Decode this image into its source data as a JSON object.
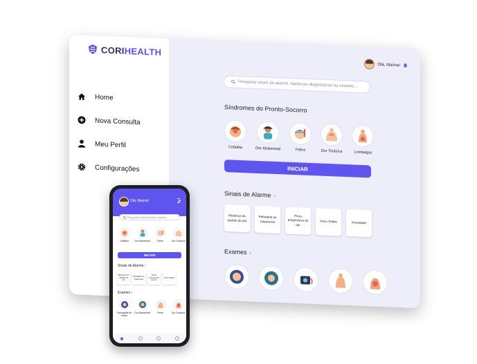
{
  "brand": {
    "part1": "CORI",
    "part2": "HEALTH"
  },
  "sidebar": {
    "items": [
      {
        "label": "Home",
        "icon": "home-icon"
      },
      {
        "label": "Nova Consulta",
        "icon": "plus-circle-icon"
      },
      {
        "label": "Meu Perfil",
        "icon": "user-icon"
      },
      {
        "label": "Configurações",
        "icon": "gear-icon"
      }
    ]
  },
  "header": {
    "greeting": "Olá, Marina!"
  },
  "search": {
    "placeholder": "Pesquisar sinais de alarme, hipóteses diagnósticas ou exames..."
  },
  "syndromes": {
    "title": "Síndromes do Pronto-Socorro",
    "items": [
      {
        "label": "Cefaléia",
        "icon": "headache-icon"
      },
      {
        "label": "Dor Abdominal",
        "icon": "abdominal-pain-icon"
      },
      {
        "label": "Febre",
        "icon": "fever-icon"
      },
      {
        "label": "Dor Torácica",
        "icon": "chest-pain-icon"
      },
      {
        "label": "Lombalgia",
        "icon": "back-pain-icon"
      }
    ]
  },
  "actions": {
    "start_label": "INICIAR"
  },
  "alarms": {
    "title": "Sinais de Alarme",
    "items": [
      "Mudança do padrão da dor",
      "Refratária ao tratamento",
      "Piora progressiva da dor",
      "Início Súbito",
      "Imunidade"
    ]
  },
  "exams": {
    "title": "Exames"
  },
  "phone": {
    "greeting": "Olá, Marina!",
    "search_placeholder": "Pesquisar sinais de alarme, exames...",
    "syndromes": [
      "Cefaléia",
      "Dor Abdominal",
      "Febre",
      "Dor Torácica"
    ],
    "start_label": "INICIAR",
    "alarms_title": "Sinais de Alarme",
    "alarms": [
      "Mudança do padrão da dor",
      "Refratária ao tratamento",
      "Piora progressiva da dor",
      "Início Súbito"
    ],
    "exams_title": "Exames",
    "exams": [
      "Tomografia de crânio",
      "Dor Abdominal",
      "Febre",
      "Dor Torácica"
    ]
  },
  "colors": {
    "accent": "#5f54ee",
    "background": "#eeeefa",
    "brand_dark": "#2c2f6b"
  }
}
